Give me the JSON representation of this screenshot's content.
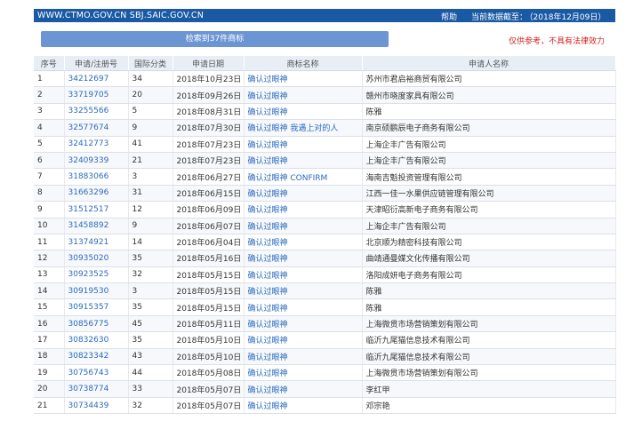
{
  "header": {
    "domains": "WWW.CTMO.GOV.CN SBJ.SAIC.GOV.CN",
    "help": "帮助",
    "update_label": "当前数据截至：",
    "update_value": "（2018年12月09日）"
  },
  "result_bar": "检索到37件商标",
  "disclaimer": "仅供参考，不具有法律效力",
  "table": {
    "headers": [
      "序号",
      "申请/注册号",
      "国际分类",
      "申请日期",
      "商标名称",
      "申请人名称"
    ],
    "rows": [
      [
        "1",
        "34212697",
        "34",
        "2018年10月23日",
        "确认过眼神",
        "苏州市君启裕商贸有限公司"
      ],
      [
        "2",
        "33719705",
        "20",
        "2018年09月26日",
        "确认过眼神",
        "赣州市晓度家具有限公司"
      ],
      [
        "3",
        "33255566",
        "5",
        "2018年08月31日",
        "确认过眼神",
        "陈雅"
      ],
      [
        "4",
        "32577674",
        "9",
        "2018年07月30日",
        "确认过眼神 我遇上对的人",
        "南京硕鹏辰电子商务有限公司"
      ],
      [
        "5",
        "32412773",
        "41",
        "2018年07月23日",
        "确认过眼神",
        "上海企丰广告有限公司"
      ],
      [
        "6",
        "32409339",
        "21",
        "2018年07月23日",
        "确认过眼神",
        "上海企丰广告有限公司"
      ],
      [
        "7",
        "31883066",
        "3",
        "2018年06月27日",
        "确认过眼神 CONFIRM",
        "海南吉魁投资管理有限公司"
      ],
      [
        "8",
        "31663296",
        "31",
        "2018年06月15日",
        "确认过眼神",
        "江西一佳一水果供应链管理有限公司"
      ],
      [
        "9",
        "31512517",
        "12",
        "2018年06月09日",
        "确认过眼神",
        "天津昭衍高新电子商务有限公司"
      ],
      [
        "10",
        "31458892",
        "9",
        "2018年06月07日",
        "确认过眼神",
        "上海企丰广告有限公司"
      ],
      [
        "11",
        "31374921",
        "14",
        "2018年06月04日",
        "确认过眼神",
        "北京顺为精密科技有限公司"
      ],
      [
        "12",
        "30935020",
        "35",
        "2018年05月16日",
        "确认过眼神",
        "曲靖通曼媒文化传播有限公司"
      ],
      [
        "13",
        "30923525",
        "32",
        "2018年05月15日",
        "确认过眼神",
        "洛阳成妍电子商务有限公司"
      ],
      [
        "14",
        "30919530",
        "3",
        "2018年05月15日",
        "确认过眼神",
        "陈雅"
      ],
      [
        "15",
        "30915357",
        "35",
        "2018年05月15日",
        "确认过眼神",
        "陈雅"
      ],
      [
        "16",
        "30856775",
        "45",
        "2018年05月11日",
        "确认过眼神",
        "上海微贯市场营销策划有限公司"
      ],
      [
        "17",
        "30832630",
        "35",
        "2018年05月10日",
        "确认过眼神",
        "临沂九尾猫信息技术有限公司"
      ],
      [
        "18",
        "30823342",
        "43",
        "2018年05月10日",
        "确认过眼神",
        "临沂九尾猫信息技术有限公司"
      ],
      [
        "19",
        "30756743",
        "44",
        "2018年05月08日",
        "确认过眼神",
        "上海微贯市场营销策划有限公司"
      ],
      [
        "20",
        "30738774",
        "33",
        "2018年05月07日",
        "确认过眼神",
        "李红甲"
      ],
      [
        "21",
        "30734439",
        "32",
        "2018年05月07日",
        "确认过眼神",
        "邓宗艳"
      ]
    ]
  },
  "colors": {
    "header_bar": "#1a5aa5",
    "result_bar": "#6c95d4",
    "disclaimer": "#d22222",
    "link": "#2a6bbf",
    "table_header_bg": "#e8eef6"
  }
}
